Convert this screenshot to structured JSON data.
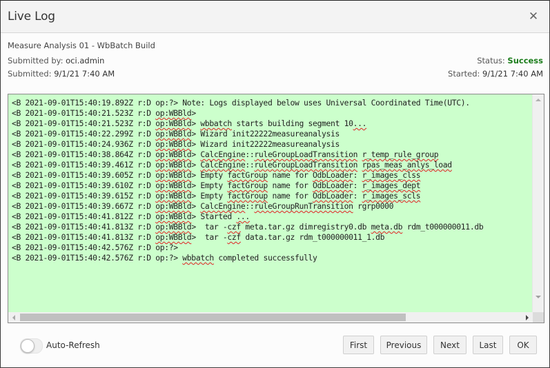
{
  "dialog": {
    "title": "Live Log",
    "close_icon": "close-icon"
  },
  "job": {
    "name": "Measure Analysis 01 - WbBatch Build",
    "submitted_by_label": "Submitted by: ",
    "submitted_by": "oci.admin",
    "submitted_label": "Submitted: ",
    "submitted": "9/1/21 7:40 AM",
    "status_label": "Status: ",
    "status": "Success",
    "started_label": "Started: ",
    "started": "9/1/21 7:40 AM"
  },
  "colors": {
    "log_background": "#ccffcc",
    "status_success": "#1b7d1b",
    "header_background": "#f3f3f3"
  },
  "log": {
    "lines": [
      "<B 2021-09-01T15:40:19.892Z r:D op:?> Note: Logs displayed below uses Universal Coordinated Time(UTC).",
      "<B 2021-09-01T15:40:21.523Z r:D op:WBBld>",
      "<B 2021-09-01T15:40:21.523Z r:D op:WBBld> wbbatch starts building segment 10...",
      "<B 2021-09-01T15:40:22.299Z r:D op:WBBld> Wizard init22222measureanalysis",
      "<B 2021-09-01T15:40:24.936Z r:D op:WBBld> Wizard init22222measureanalysis",
      "<B 2021-09-01T15:40:38.864Z r:D op:WBBld> CalcEngine::ruleGroupLoadTransition r_temp_rule_group",
      "<B 2021-09-01T15:40:39.461Z r:D op:WBBld> CalcEngine::ruleGroupLoadTransition rpas_meas_anlys_load",
      "<B 2021-09-01T15:40:39.605Z r:D op:WBBld> Empty factGroup name for OdbLoader: r_images_clss",
      "<B 2021-09-01T15:40:39.610Z r:D op:WBBld> Empty factGroup name for OdbLoader: r_images_dept",
      "<B 2021-09-01T15:40:39.615Z r:D op:WBBld> Empty factGroup name for OdbLoader: r_images_scls",
      "<B 2021-09-01T15:40:39.667Z r:D op:WBBld> CalcEngine::ruleGroupRunTransition rgrp0000",
      "<B 2021-09-01T15:40:41.812Z r:D op:WBBld> Started ...",
      "<B 2021-09-01T15:40:41.813Z r:D op:WBBld>  tar -czf meta.tar.gz dimregistry0.db meta.db rdm_t000000011.db",
      "<B 2021-09-01T15:40:41.813Z r:D op:WBBld>  tar -czf data.tar.gz rdm_t000000011_1.db",
      "<B 2021-09-01T15:40:42.576Z r:D op:?>",
      "<B 2021-09-01T15:40:42.576Z r:D op:?> wbbatch completed successfully"
    ],
    "horizontal_scroll_fraction": 0.0
  },
  "footer": {
    "auto_refresh_label": "Auto-Refresh",
    "auto_refresh_on": false,
    "buttons": {
      "first": "First",
      "previous": "Previous",
      "next": "Next",
      "last": "Last",
      "ok": "OK"
    }
  }
}
